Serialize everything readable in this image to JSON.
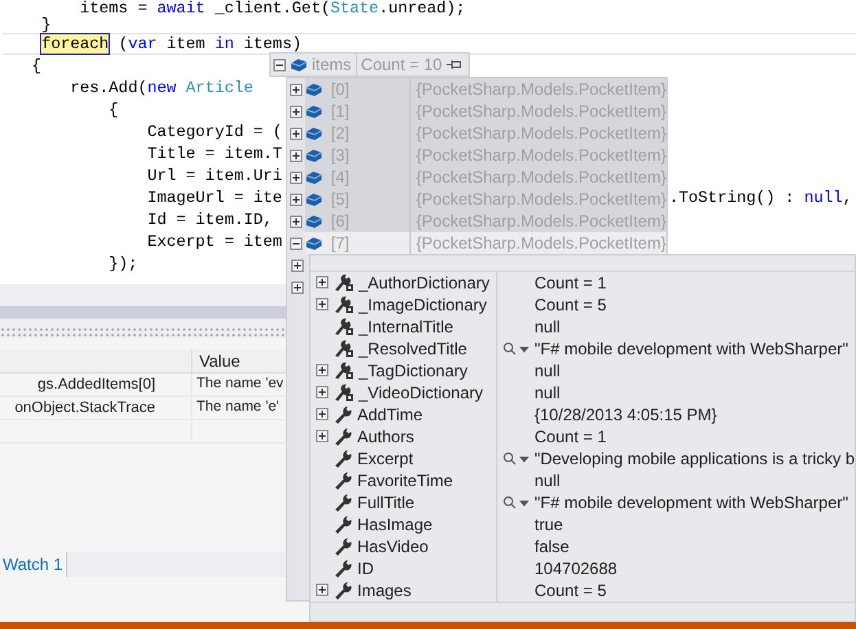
{
  "code_lines": [
    {
      "tokens": [
        {
          "kind": "plain",
          "text": "        items = "
        },
        {
          "kind": "kw",
          "text": "await"
        },
        {
          "kind": "plain",
          "text": " _client.Get("
        },
        {
          "kind": "type",
          "text": "State"
        },
        {
          "kind": "plain",
          "text": ".unread);"
        }
      ]
    },
    {
      "tokens": [
        {
          "kind": "plain",
          "text": "    }"
        }
      ]
    },
    {
      "current": true,
      "tokens": [
        {
          "kind": "plain",
          "text": "    foreach",
          "highlighted": true
        },
        {
          "kind": "plain",
          "text": " ("
        },
        {
          "kind": "kw",
          "text": "var"
        },
        {
          "kind": "plain",
          "text": " item "
        },
        {
          "kind": "kw",
          "text": "in"
        },
        {
          "kind": "plain",
          "text": " items)"
        }
      ]
    },
    {
      "tokens": [
        {
          "kind": "plain",
          "text": "   {"
        }
      ]
    },
    {
      "tokens": [
        {
          "kind": "plain",
          "text": "       res.Add("
        },
        {
          "kind": "kw",
          "text": "new"
        },
        {
          "kind": "type",
          "text": " Article"
        }
      ]
    },
    {
      "tokens": [
        {
          "kind": "plain",
          "text": "           {"
        }
      ]
    },
    {
      "tokens": [
        {
          "kind": "plain",
          "text": "               CategoryId = ("
        }
      ]
    },
    {
      "tokens": [
        {
          "kind": "plain",
          "text": "               Title = item.T"
        }
      ]
    },
    {
      "tokens": [
        {
          "kind": "plain",
          "text": "               Url = item.Uri"
        }
      ]
    },
    {
      "tokens": [
        {
          "kind": "plain",
          "text": "               ImageUrl = ite"
        }
      ],
      "tail": [
        {
          "kind": "plain",
          "text": ".ToString() : "
        },
        {
          "kind": "kw",
          "text": "null"
        },
        {
          "kind": "plain",
          "text": ","
        }
      ]
    },
    {
      "tokens": [
        {
          "kind": "plain",
          "text": "               Id = item.ID,"
        }
      ]
    },
    {
      "tokens": [
        {
          "kind": "plain",
          "text": "               Excerpt = item"
        }
      ]
    },
    {
      "tokens": [
        {
          "kind": "plain",
          "text": "           });"
        }
      ]
    }
  ],
  "watch": {
    "columns": [
      {
        "label": "Value"
      }
    ],
    "rows": [
      {
        "name": "gs.AddedItems[0]",
        "value": "The name 'ev"
      },
      {
        "name": "onObject.StackTrace",
        "value": "The name 'e'"
      }
    ],
    "tabs": [
      {
        "label": "Watch 1",
        "selected": true
      }
    ]
  },
  "datatip": {
    "name": "items",
    "value": "Count = 10",
    "expanded": true,
    "items": [
      {
        "name": "[0]",
        "value": "{PocketSharp.Models.PocketItem}",
        "expanded": false,
        "selected": false
      },
      {
        "name": "[1]",
        "value": "{PocketSharp.Models.PocketItem}",
        "expanded": false,
        "selected": false
      },
      {
        "name": "[2]",
        "value": "{PocketSharp.Models.PocketItem}",
        "expanded": false,
        "selected": false
      },
      {
        "name": "[3]",
        "value": "{PocketSharp.Models.PocketItem}",
        "expanded": false,
        "selected": false
      },
      {
        "name": "[4]",
        "value": "{PocketSharp.Models.PocketItem}",
        "expanded": false,
        "selected": false
      },
      {
        "name": "[5]",
        "value": "{PocketSharp.Models.PocketItem}",
        "expanded": false,
        "selected": false
      },
      {
        "name": "[6]",
        "value": "{PocketSharp.Models.PocketItem}",
        "expanded": false,
        "selected": false
      },
      {
        "name": "[7]",
        "value": "{PocketSharp.Models.PocketItem}",
        "expanded": true,
        "selected": true
      }
    ],
    "covered_rows": [
      {
        "expanded": false
      },
      {
        "expanded": false
      }
    ],
    "members": [
      {
        "kind": "field",
        "name": "_AuthorDictionary",
        "value": "Count = 1",
        "expandable": true,
        "visualizer": false
      },
      {
        "kind": "field",
        "name": "_ImageDictionary",
        "value": "Count = 5",
        "expandable": true,
        "visualizer": false
      },
      {
        "kind": "field",
        "name": "_InternalTitle",
        "value": "null",
        "expandable": false,
        "visualizer": false
      },
      {
        "kind": "field",
        "name": "_ResolvedTitle",
        "value": "\"F# mobile development with WebSharper\"",
        "expandable": false,
        "visualizer": true
      },
      {
        "kind": "field",
        "name": "_TagDictionary",
        "value": "null",
        "expandable": true,
        "visualizer": false
      },
      {
        "kind": "field",
        "name": "_VideoDictionary",
        "value": "null",
        "expandable": true,
        "visualizer": false
      },
      {
        "kind": "property",
        "name": "AddTime",
        "value": "{10/28/2013 4:05:15 PM}",
        "expandable": true,
        "visualizer": false
      },
      {
        "kind": "property",
        "name": "Authors",
        "value": "Count = 1",
        "expandable": true,
        "visualizer": false
      },
      {
        "kind": "property",
        "name": "Excerpt",
        "value": "\"Developing mobile applications is a tricky b",
        "expandable": false,
        "visualizer": true
      },
      {
        "kind": "property",
        "name": "FavoriteTime",
        "value": "null",
        "expandable": false,
        "visualizer": false
      },
      {
        "kind": "property",
        "name": "FullTitle",
        "value": "\"F# mobile development with WebSharper\"",
        "expandable": false,
        "visualizer": true
      },
      {
        "kind": "property",
        "name": "HasImage",
        "value": "true",
        "expandable": false,
        "visualizer": false
      },
      {
        "kind": "property",
        "name": "HasVideo",
        "value": "false",
        "expandable": false,
        "visualizer": false
      },
      {
        "kind": "property",
        "name": "ID",
        "value": "104702688",
        "expandable": false,
        "visualizer": false
      },
      {
        "kind": "property",
        "name": "Images",
        "value": "Count = 5",
        "expandable": true,
        "visualizer": false
      }
    ]
  }
}
